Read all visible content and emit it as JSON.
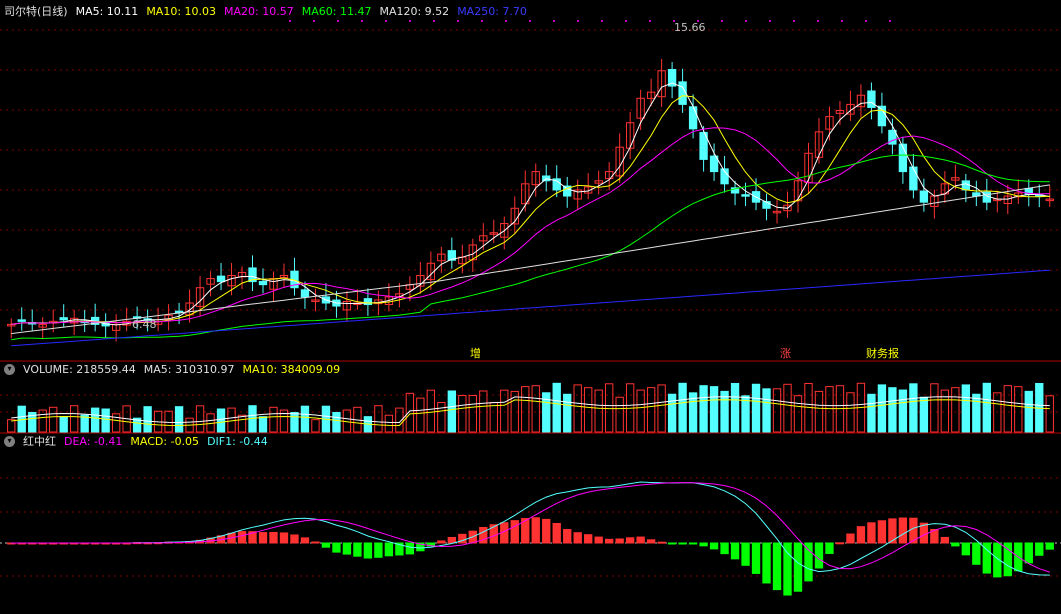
{
  "price_panel": {
    "title": "司尔特(日线)",
    "ma": [
      {
        "label": "MA5: 10.11",
        "color": "#ffffff"
      },
      {
        "label": "MA10: 10.03",
        "color": "#ffff00"
      },
      {
        "label": "MA20: 10.57",
        "color": "#ff00ff"
      },
      {
        "label": "MA60: 11.47",
        "color": "#00ff00"
      },
      {
        "label": "MA120: 9.52",
        "color": "#e0e0e0"
      },
      {
        "label": "MA250: 7.70",
        "color": "#2020ff"
      }
    ],
    "high_label": "15.66",
    "low_label": "6.48",
    "event_marks": [
      "增",
      "涨",
      "财务报"
    ]
  },
  "volume_panel": {
    "title": "VOLUME: 218559.44",
    "ma5": "MA5: 310310.97",
    "ma10": "MA10: 384009.09"
  },
  "macd_panel": {
    "title": "红中红",
    "dea": "DEA: -0.41",
    "macd": "MACD: -0.05",
    "dif": "DIF1: -0.44"
  },
  "colors": {
    "up": "#ff3232",
    "down": "#54ffff",
    "grid": "#800000",
    "border": "#b00000"
  },
  "chart_data": {
    "type": "candlestick",
    "ohlc_close_path": [
      6.6,
      6.7,
      6.65,
      6.6,
      6.7,
      6.75,
      6.8,
      6.7,
      6.6,
      6.55,
      6.6,
      6.7,
      6.8,
      6.75,
      6.7,
      6.9,
      7.0,
      7.3,
      7.8,
      8.1,
      8.0,
      8.2,
      8.3,
      8.0,
      7.9,
      8.1,
      8.2,
      7.8,
      7.5,
      7.4,
      7.3,
      7.2,
      7.35,
      7.3,
      7.25,
      7.4,
      7.5,
      7.6,
      7.9,
      8.2,
      8.6,
      8.9,
      8.7,
      8.8,
      9.2,
      9.5,
      9.6,
      9.9,
      10.4,
      11.2,
      11.6,
      11.3,
      11.0,
      10.8,
      11.0,
      11.1,
      11.3,
      11.6,
      12.4,
      13.2,
      14.0,
      14.2,
      14.9,
      14.4,
      13.8,
      13.0,
      12.0,
      11.6,
      11.2,
      10.9,
      10.8,
      10.6,
      10.4,
      10.3,
      10.5,
      11.3,
      12.2,
      12.9,
      13.4,
      13.6,
      13.8,
      14.1,
      13.7,
      13.1,
      12.5,
      11.6,
      11.0,
      10.6,
      10.8,
      11.2,
      11.4,
      11.0,
      10.8,
      10.6,
      10.7,
      10.8,
      10.9,
      10.85,
      10.8,
      10.7
    ],
    "ma_legend": [
      "MA5",
      "MA10",
      "MA20",
      "MA60",
      "MA120",
      "MA250"
    ],
    "high": 15.66,
    "low": 6.48
  }
}
